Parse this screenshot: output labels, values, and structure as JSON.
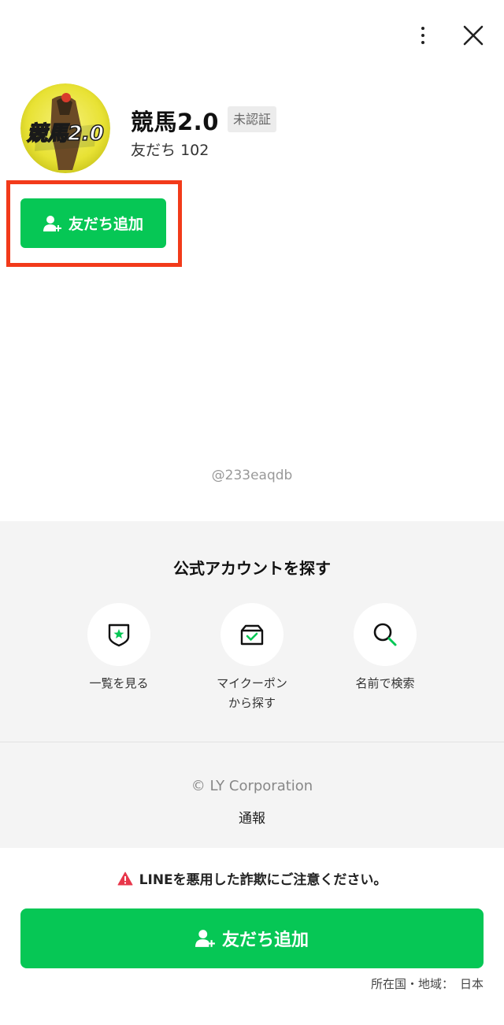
{
  "header": {
    "more_icon": "more-vertical-icon",
    "close_icon": "close-icon"
  },
  "profile": {
    "name": "競馬2.0",
    "verify_badge": "未認証",
    "friends_label": "友だち",
    "friends_count": "102",
    "avatar_text": "競馬2.0"
  },
  "add_friend_top": {
    "label": "友だち追加",
    "icon": "add-user-icon"
  },
  "account_id": "@233eaqdb",
  "explore": {
    "title": "公式アカウントを探す",
    "items": [
      {
        "label": "一覧を見る",
        "icon": "shield-star-icon"
      },
      {
        "label": "マイクーポン\nから探す",
        "icon": "coupon-box-icon"
      },
      {
        "label": "名前で検索",
        "icon": "search-icon"
      }
    ]
  },
  "footer": {
    "copyright": "© LY Corporation",
    "report": "通報"
  },
  "bottom": {
    "warning": "LINEを悪用した詐欺にご注意ください。",
    "warning_icon": "warning-icon",
    "add_friend_label": "友だち追加",
    "region_label": "所在国・地域：",
    "region_value": "日本"
  },
  "colors": {
    "line_green": "#06c755",
    "highlight_red": "#f23a1a",
    "warning_red": "#e8374b"
  }
}
